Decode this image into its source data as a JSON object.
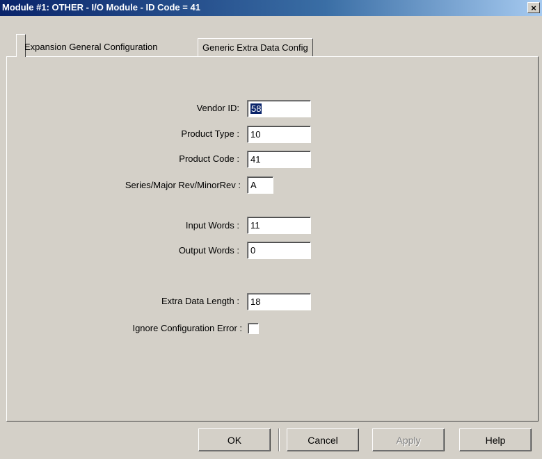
{
  "window": {
    "title": "Module #1: OTHER - I/O Module - ID Code = 41",
    "close_label": "×"
  },
  "tabs": [
    {
      "label": "Expansion General Configuration",
      "active": true
    },
    {
      "label": "Generic Extra Data Config",
      "active": false
    }
  ],
  "form": {
    "vendor_id_label": "Vendor ID:",
    "vendor_id_value": "58",
    "product_type_label": "Product Type :",
    "product_type_value": "10",
    "product_code_label": "Product Code :",
    "product_code_value": "41",
    "series_label": "Series/Major Rev/MinorRev :",
    "series_value": "A",
    "input_words_label": "Input Words :",
    "input_words_value": "11",
    "output_words_label": "Output Words :",
    "output_words_value": "0",
    "extra_data_length_label": "Extra Data Length :",
    "extra_data_length_value": "18",
    "ignore_config_error_label": "Ignore Configuration Error :",
    "ignore_config_error_checked": false
  },
  "buttons": {
    "ok": "OK",
    "cancel": "Cancel",
    "apply": "Apply",
    "help": "Help"
  }
}
